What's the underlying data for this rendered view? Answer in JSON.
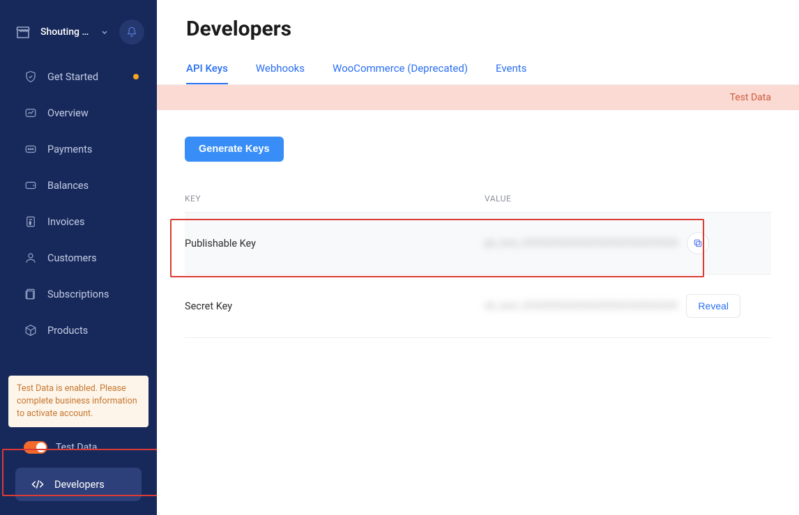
{
  "header": {
    "store_name": "Shouting Pi…"
  },
  "sidebar": {
    "items": [
      {
        "label": "Get Started",
        "has_dot": true
      },
      {
        "label": "Overview"
      },
      {
        "label": "Payments"
      },
      {
        "label": "Balances"
      },
      {
        "label": "Invoices"
      },
      {
        "label": "Customers"
      },
      {
        "label": "Subscriptions"
      },
      {
        "label": "Products"
      }
    ],
    "warning": "Test Data is enabled. Please complete business information to activate account.",
    "toggle_label": "Test Data",
    "developers_label": "Developers"
  },
  "page": {
    "title": "Developers",
    "tabs": [
      {
        "label": "API Keys",
        "active": true
      },
      {
        "label": "Webhooks"
      },
      {
        "label": "WooCommerce (Deprecated)"
      },
      {
        "label": "Events"
      }
    ],
    "test_banner": "Test Data",
    "generate_button": "Generate Keys",
    "table": {
      "col_key": "KEY",
      "col_value": "VALUE",
      "rows": [
        {
          "key": "Publishable Key",
          "value": "pk_test_XXXXXXXXXXXXXXXXXXXXXXXX",
          "action": "copy"
        },
        {
          "key": "Secret Key",
          "value": "sk_test_XXXXXXXXXXXXXXXXXXXXXXXX",
          "action": "reveal"
        }
      ],
      "reveal_label": "Reveal"
    }
  },
  "colors": {
    "sidebar_bg": "#17285b",
    "accent": "#2a6ff2",
    "warning_bg": "#fdf5ea",
    "banner_bg": "#fadad3",
    "toggle_on": "#f36a2c",
    "highlight_border": "#da3b34"
  }
}
